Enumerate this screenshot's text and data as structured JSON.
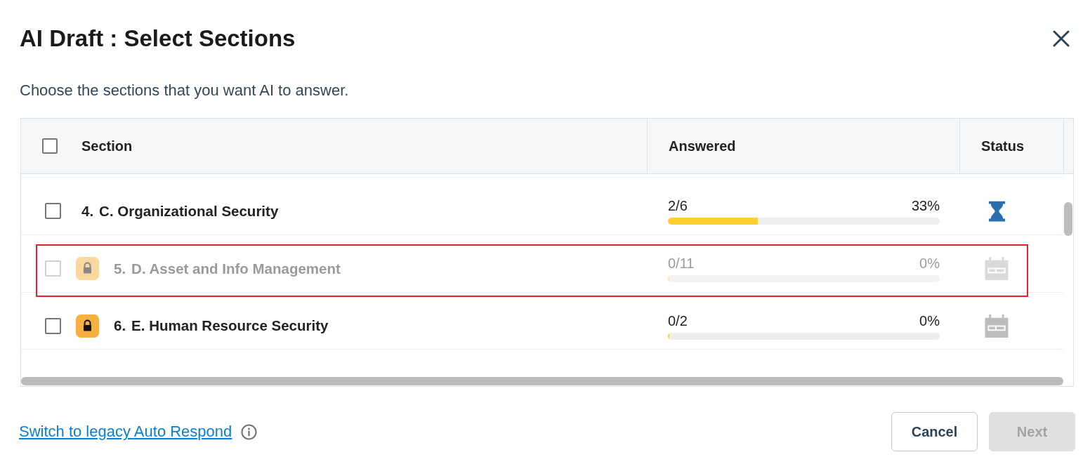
{
  "dialog": {
    "title": "AI Draft : Select Sections",
    "subtitle": "Choose the sections that you want AI to answer."
  },
  "table": {
    "select_all": {
      "checked": false
    },
    "columns": [
      "Section",
      "Answered",
      "Status"
    ],
    "rows": [
      {
        "number": "4.",
        "name": "C. Organizational Security",
        "checked": false,
        "disabled": false,
        "locked": false,
        "highlighted": false,
        "answered": "2/6",
        "percent": "33%",
        "level": 0.33,
        "status": {
          "kind": "started"
        }
      },
      {
        "number": "5.",
        "name": "D. Asset and Info Management",
        "checked": false,
        "disabled": true,
        "locked": true,
        "highlighted": true,
        "answered": "0/11",
        "percent": "0%",
        "level": 0,
        "status": {
          "kind": "pending"
        }
      },
      {
        "number": "6.",
        "name": "E. Human Resource Security",
        "checked": false,
        "disabled": false,
        "locked": true,
        "highlighted": false,
        "answered": "0/2",
        "percent": "0%",
        "level": 0,
        "status": {
          "kind": "pending"
        }
      }
    ]
  },
  "footer": {
    "link": "Switch to legacy Auto Respond",
    "buttons": [
      {
        "label": "Cancel",
        "kind": "secondary",
        "disabled": false
      },
      {
        "label": "Next",
        "kind": "primary",
        "disabled": true
      }
    ]
  }
}
